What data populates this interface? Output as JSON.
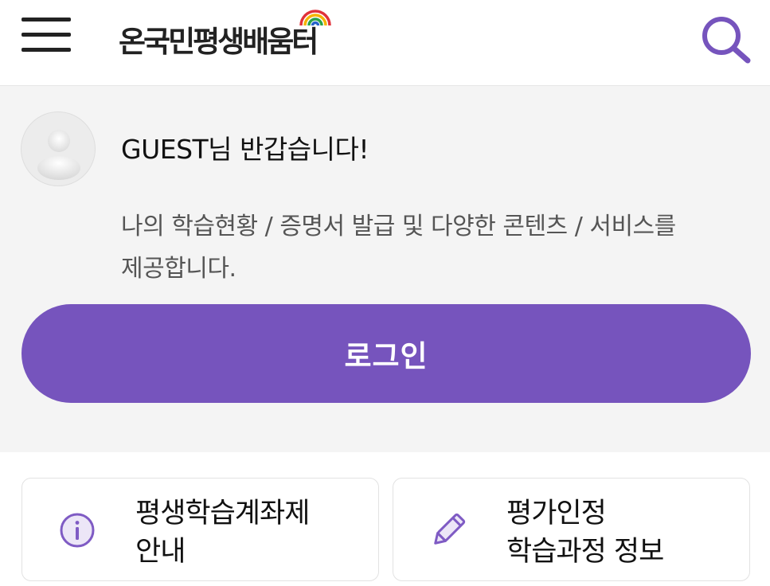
{
  "header": {
    "logo_text": "온국민평생배움터",
    "menu_icon": "hamburger-menu-icon",
    "search_icon": "search-icon",
    "accent_color": "#7654bd"
  },
  "profile": {
    "avatar_icon": "user-avatar-icon",
    "greeting": "GUEST님 반갑습니다!",
    "description": "나의 학습현황 / 증명서 발급 및 다양한 콘텐츠 / 서비스를 제공합니다.",
    "login_label": "로그인"
  },
  "cards": [
    {
      "icon": "info-icon",
      "label": "평생학습계좌제\n안내"
    },
    {
      "icon": "pencil-icon",
      "label": "평가인정\n학습과정 정보"
    }
  ]
}
